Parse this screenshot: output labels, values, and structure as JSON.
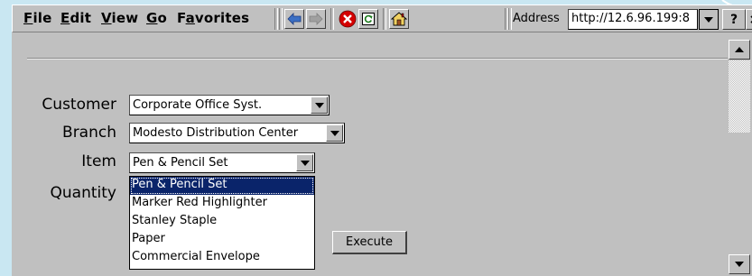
{
  "menu": {
    "file": {
      "u": "F",
      "rest": "ile"
    },
    "edit": {
      "u": "E",
      "rest": "dit"
    },
    "view": {
      "u": "V",
      "rest": "iew"
    },
    "go": {
      "u": "G",
      "rest": "o"
    },
    "favorites": {
      "pre": "F",
      "u": "a",
      "rest": "vorites"
    }
  },
  "toolbar": {
    "icons": [
      "back-arrow-icon",
      "forward-arrow-icon",
      "stop-icon",
      "refresh-icon",
      "home-icon"
    ],
    "address_label": "Address",
    "address_value": "http://12.6.96.199:8",
    "help_label": "?",
    "close_label": "×"
  },
  "form": {
    "customer": {
      "label": "Customer",
      "value": "Corporate Office Syst."
    },
    "branch": {
      "label": "Branch",
      "value": "Modesto Distribution Center"
    },
    "item": {
      "label": "Item",
      "value": "Pen & Pencil Set",
      "options": [
        "Pen & Pencil Set",
        "Marker Red Highlighter",
        "Stanley Staple",
        "Paper",
        "Commercial Envelope"
      ],
      "selected_index": 0
    },
    "quantity": {
      "label": "Quantity"
    },
    "execute_label": "Execute"
  },
  "colors": {
    "selection": "#0a246a",
    "chrome": "#c0c0c0",
    "stop_red": "#d40000"
  }
}
